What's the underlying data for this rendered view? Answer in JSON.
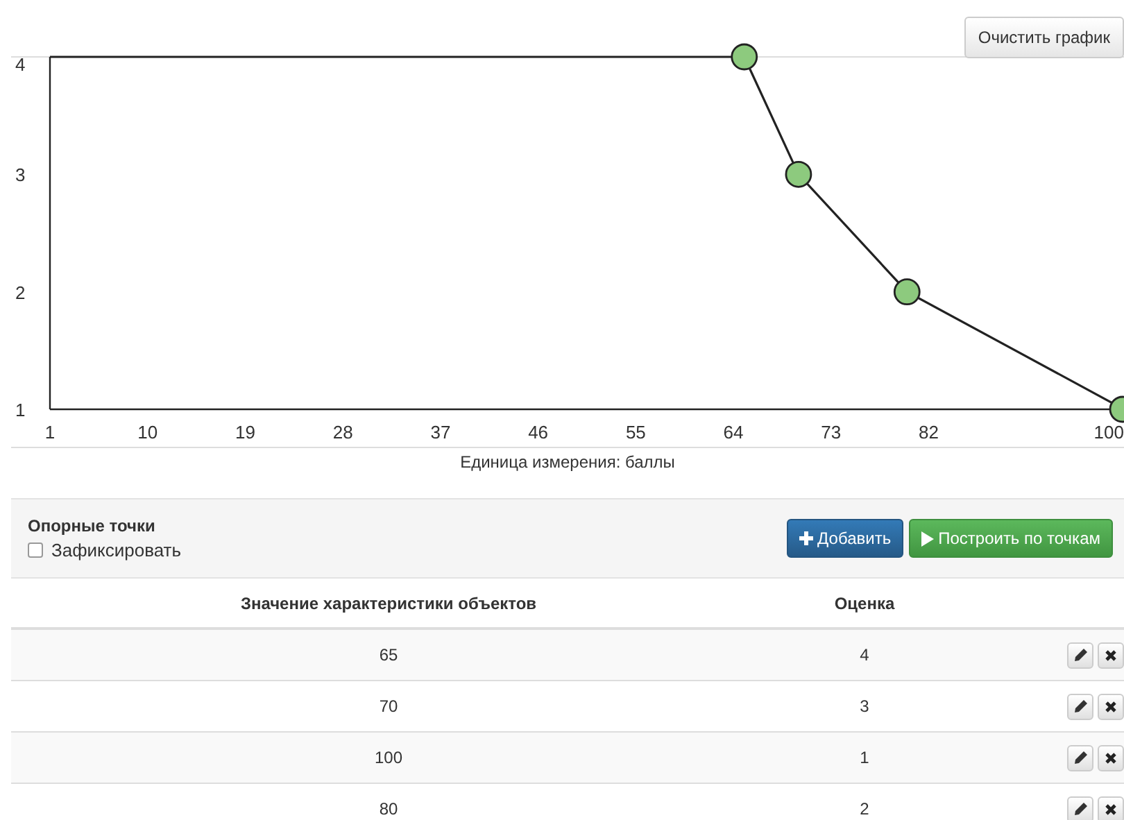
{
  "clear_button": "Очистить график",
  "chart": {
    "chart_data": {
      "type": "line",
      "xlabel": "Единица измерения: баллы",
      "xlim": [
        1,
        100
      ],
      "ylim": [
        1,
        4
      ],
      "xticks": [
        1,
        10,
        19,
        28,
        37,
        46,
        55,
        64,
        73,
        82,
        100
      ],
      "yticks": [
        1,
        2,
        3,
        4
      ],
      "series": [
        {
          "color": "#8dca7e",
          "marker": "circle",
          "x": [
            65,
            70,
            80,
            100
          ],
          "values": [
            4,
            3,
            2,
            1
          ]
        }
      ]
    }
  },
  "panel": {
    "title": "Опорные точки",
    "fix_checkbox": {
      "label": "Зафиксировать",
      "checked": false
    },
    "add_button": "Добавить",
    "build_button": "Построить по точкам"
  },
  "table": {
    "columns": [
      "Значение характеристики объектов",
      "Оценка"
    ],
    "rows": [
      {
        "value": "65",
        "score": "4"
      },
      {
        "value": "70",
        "score": "3"
      },
      {
        "value": "100",
        "score": "1"
      },
      {
        "value": "80",
        "score": "2"
      }
    ]
  }
}
